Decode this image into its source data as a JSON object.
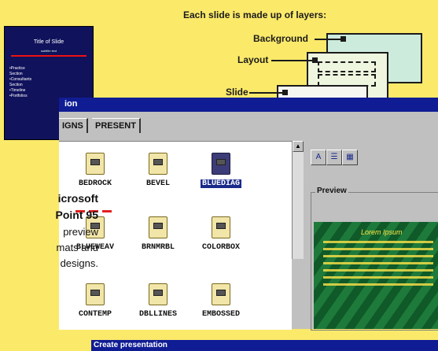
{
  "diagram": {
    "caption": "Each slide is made up of layers:",
    "labels": {
      "background": "Background",
      "layout": "Layout",
      "slide": "Slide"
    }
  },
  "mini_slide": {
    "title": "Title of Slide",
    "subtitle": "subtitle text",
    "bullets": [
      "•Practice",
      "  Section",
      "•Consultants",
      "  Section",
      "•Timeline",
      "•Portfolios"
    ]
  },
  "window": {
    "title": "ion",
    "tabs": [
      "IGNS",
      "PRESENT"
    ],
    "templates": [
      {
        "name": "BEDROCK",
        "selected": false
      },
      {
        "name": "BEVEL",
        "selected": false
      },
      {
        "name": "BLUEDIAG",
        "selected": true
      },
      {
        "name": "BLUEWEAV",
        "selected": false
      },
      {
        "name": "BRNMRBL",
        "selected": false
      },
      {
        "name": "COLORBOX",
        "selected": false
      },
      {
        "name": "CONTEMP",
        "selected": false
      },
      {
        "name": "DBLLINES",
        "selected": false
      },
      {
        "name": "EMBOSSED",
        "selected": false
      }
    ],
    "view_buttons": [
      "A",
      "☰",
      "▦"
    ],
    "preview_label": "Preview",
    "preview_title": "Lorem Ipsum",
    "status": "Create presentation"
  },
  "callout": {
    "line1": "icrosoft",
    "line2": "Point 95",
    "line3": "preview",
    "line4": "mats and",
    "line5": "designs."
  },
  "colors": {
    "page_bg": "#fbe96a",
    "title_bar": "#101c94",
    "accent_red": "#e41f1f"
  }
}
